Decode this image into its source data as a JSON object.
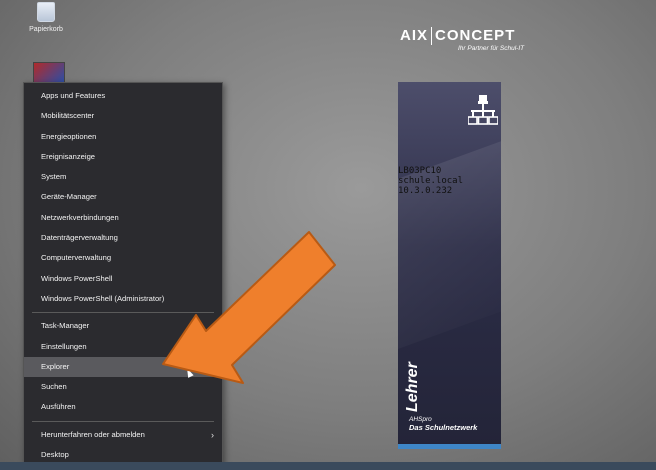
{
  "desktop": {
    "recycle_bin_label": "Papierkorb"
  },
  "context_menu": {
    "groups": [
      [
        "Apps und Features",
        "Mobilitätscenter",
        "Energieoptionen",
        "Ereignisanzeige",
        "System",
        "Geräte-Manager",
        "Netzwerkverbindungen",
        "Datenträgerverwaltung",
        "Computerverwaltung",
        "Windows PowerShell",
        "Windows PowerShell (Administrator)"
      ],
      [
        "Task-Manager",
        "Einstellungen",
        "Explorer",
        "Suchen",
        "Ausführen"
      ],
      [
        "Herunterfahren oder abmelden",
        "Desktop"
      ]
    ],
    "highlighted_item": "Explorer",
    "submenu_indicator": "›"
  },
  "logo": {
    "brand_left": "AIX",
    "brand_right": "CONCEPT",
    "tagline": "Ihr Partner für Schul-IT"
  },
  "info_panel": {
    "hostname": "LB03PC10",
    "domain": "schule.local",
    "ip": "10.3.0.232",
    "role": "Lehrer",
    "product_line1": "AHSpro",
    "product_line2": "Das Schulnetzwerk",
    "icon": "network-tree-icon"
  },
  "colors": {
    "arrow_fill": "#ef7f2c",
    "arrow_stroke": "#b85a14",
    "menu_background": "#2b2b2f",
    "menu_highlight": "#5a5a5e",
    "panel_accent": "#3e86c7"
  }
}
